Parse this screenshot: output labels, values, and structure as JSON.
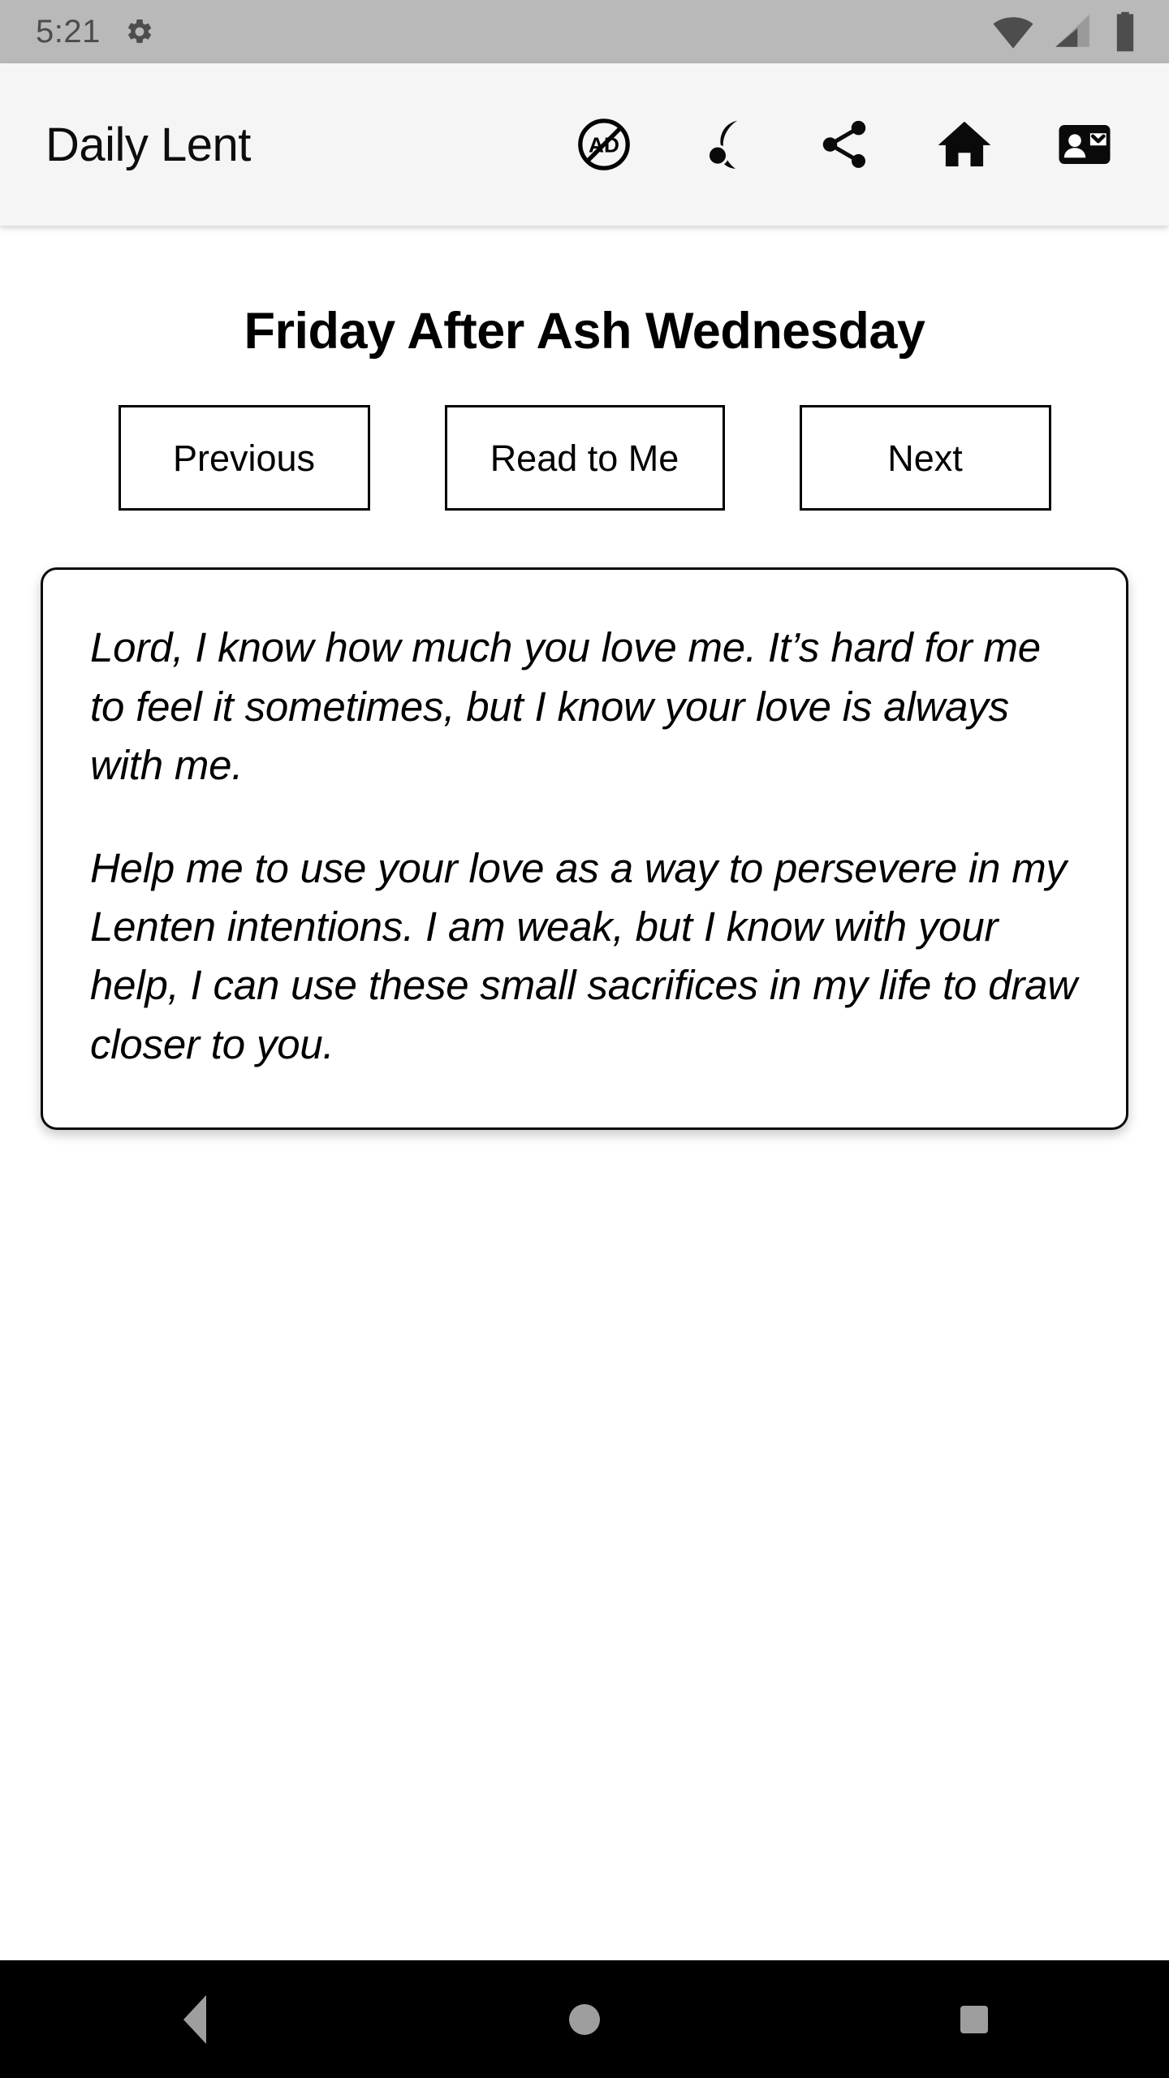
{
  "status_bar": {
    "clock": "5:21",
    "gear_icon": "gear-icon",
    "wifi_icon": "wifi-icon",
    "signal_icon": "cell-signal-icon",
    "battery_icon": "battery-full-icon",
    "background_color": "#b9b9b9"
  },
  "app_bar": {
    "title": "Daily Lent",
    "background_color": "#f5f5f5",
    "actions": [
      {
        "name": "remove-ads-button",
        "icon": "no-ads-icon"
      },
      {
        "name": "night-mode-button",
        "icon": "moon-cloud-icon"
      },
      {
        "name": "share-button",
        "icon": "share-icon"
      },
      {
        "name": "home-button",
        "icon": "home-icon"
      },
      {
        "name": "contact-button",
        "icon": "contact-card-icon"
      }
    ]
  },
  "main": {
    "page_title": "Friday After Ash Wednesday",
    "buttons": {
      "previous": "Previous",
      "read_to_me": "Read to Me",
      "next": "Next"
    },
    "prayer": {
      "paragraph_1": "Lord, I know how much you love me. It’s hard for me to feel it sometimes, but I know your love is always with me.",
      "paragraph_2": "Help me to use your love as a way to persevere in my Lenten intentions. I am weak, but I know with your help, I can use these small sacrifices in my life to draw closer to you."
    }
  },
  "nav_bar": {
    "background_color": "#000000",
    "key_color": "#9e9e9e",
    "keys": [
      {
        "name": "android-back-key",
        "icon": "triangle-back-icon"
      },
      {
        "name": "android-home-key",
        "icon": "circle-home-icon"
      },
      {
        "name": "android-recents-key",
        "icon": "square-recents-icon"
      }
    ]
  },
  "colors": {
    "text_primary": "#000000",
    "status_bar_text": "#4d4d4d",
    "card_border": "#0a0a0a",
    "page_background": "#ffffff"
  }
}
